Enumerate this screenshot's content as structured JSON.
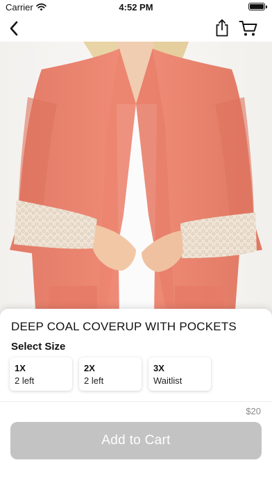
{
  "status": {
    "carrier": "Carrier",
    "time": "4:52 PM"
  },
  "nav": {
    "icons": [
      "chevron-left-icon",
      "share-icon",
      "cart-icon"
    ]
  },
  "product": {
    "title": "DEEP COAL COVERUP WITH POCKETS",
    "image_icon": "product-photo",
    "size_label": "Select Size",
    "sizes": [
      {
        "name": "1X",
        "stock": "2 left"
      },
      {
        "name": "2X",
        "stock": "2 left"
      },
      {
        "name": "3X",
        "stock": "Waitlist"
      }
    ],
    "price": "$20",
    "add_to_cart_label": "Add to Cart"
  },
  "colors": {
    "cardigan": "#ef8874",
    "button_disabled": "#c3c3c3",
    "price_text": "#8a8a8a"
  }
}
